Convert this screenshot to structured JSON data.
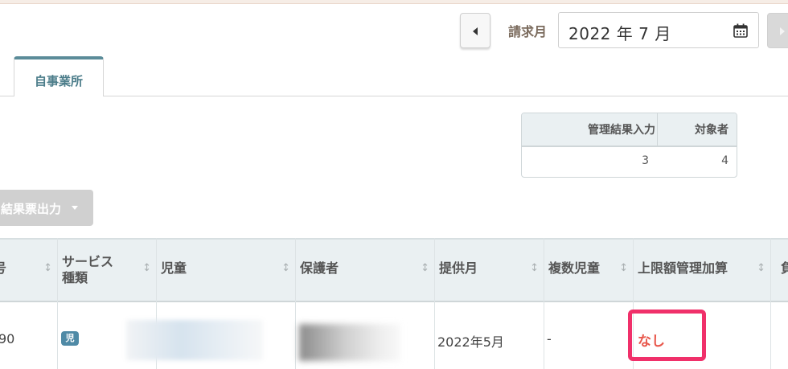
{
  "header": {
    "month_label": "請求月",
    "month_value": "2022 年 7 月"
  },
  "tabs": [
    {
      "label": "自事業所",
      "active": true
    }
  ],
  "summary": {
    "headers": [
      "管理結果入力",
      "対象者"
    ],
    "values": [
      "3",
      "4"
    ]
  },
  "output_button": {
    "label": "結果票出力"
  },
  "table": {
    "columns": [
      "番号",
      "サービス\n種類",
      "児童",
      "保護者",
      "提供月",
      "複数児童",
      "上限額管理加算",
      "負"
    ],
    "sort_icon": "↕",
    "row": {
      "number": "90",
      "service_badge": "児",
      "month": "2022年5月",
      "multiple": "-",
      "upper_limit": "なし"
    }
  },
  "colors": {
    "accent": "#5b8c99",
    "highlight": "#f0306a",
    "none_text": "#e8574b",
    "badge": "#4f8aa6"
  }
}
